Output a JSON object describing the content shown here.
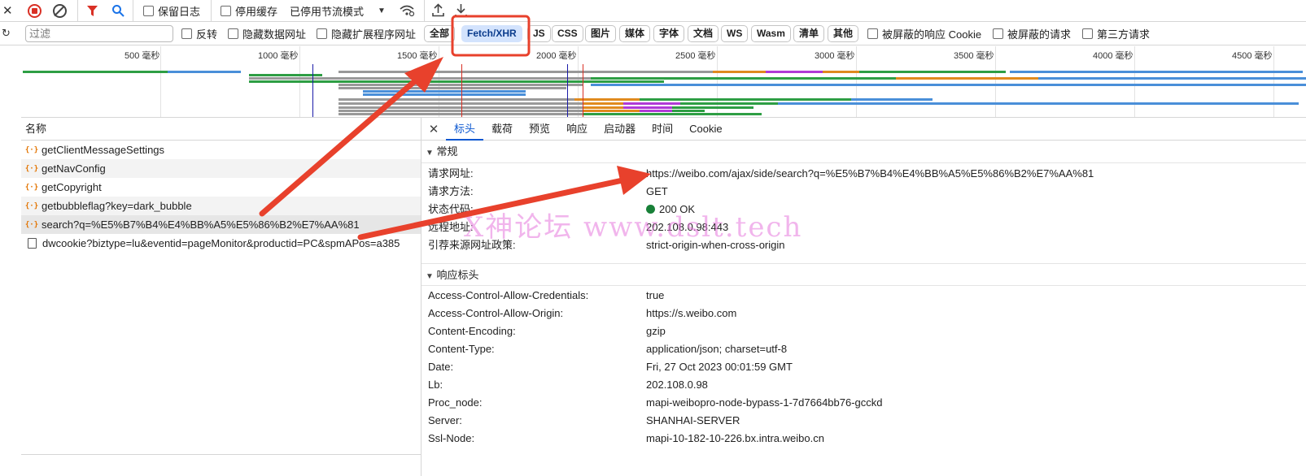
{
  "toolbar": {
    "preserve_log": "保留日志",
    "disable_cache": "停用缓存",
    "throttle": "已停用节流模式"
  },
  "filterbar": {
    "filter_placeholder": "过滤",
    "invert": "反转",
    "hide_data_urls": "隐藏数据网址",
    "hide_extension_urls": "隐藏扩展程序网址",
    "types": [
      "全部",
      "Fetch/XHR",
      "JS",
      "CSS",
      "图片",
      "媒体",
      "字体",
      "文档",
      "WS",
      "Wasm",
      "清单",
      "其他"
    ],
    "active_type": "Fetch/XHR",
    "blocked_cookies": "被屏蔽的响应 Cookie",
    "blocked_requests": "被屏蔽的请求",
    "third_party": "第三方请求"
  },
  "timeline": {
    "ticks": [
      "500 毫秒",
      "1000 毫秒",
      "1500 毫秒",
      "2000 毫秒",
      "2500 毫秒",
      "3000 毫秒",
      "3500 毫秒",
      "4000 毫秒",
      "4500 毫秒"
    ]
  },
  "requests": {
    "column_name": "名称",
    "items": [
      {
        "name": "getClientMessageSettings",
        "type": "xhr"
      },
      {
        "name": "getNavConfig",
        "type": "xhr"
      },
      {
        "name": "getCopyright",
        "type": "xhr"
      },
      {
        "name": "getbubbleflag?key=dark_bubble",
        "type": "xhr"
      },
      {
        "name": "search?q=%E5%B7%B4%E4%BB%A5%E5%86%B2%E7%AA%81",
        "type": "xhr"
      },
      {
        "name": "dwcookie?biztype=lu&eventid=pageMonitor&productid=PC&spmAPos=a385",
        "type": "doc"
      }
    ],
    "selected_index": 4
  },
  "details": {
    "tabs": [
      "标头",
      "载荷",
      "预览",
      "响应",
      "启动器",
      "时间",
      "Cookie"
    ],
    "active_tab": "标头",
    "general_title": "常规",
    "general": [
      {
        "k": "请求网址:",
        "v": "https://weibo.com/ajax/side/search?q=%E5%B7%B4%E4%BB%A5%E5%86%B2%E7%AA%81"
      },
      {
        "k": "请求方法:",
        "v": "GET"
      },
      {
        "k": "状态代码:",
        "v": "200 OK"
      },
      {
        "k": "远程地址:",
        "v": "202.108.0.98:443"
      },
      {
        "k": "引荐来源网址政策:",
        "v": "strict-origin-when-cross-origin"
      }
    ],
    "response_title": "响应标头",
    "response": [
      {
        "k": "Access-Control-Allow-Credentials:",
        "v": "true"
      },
      {
        "k": "Access-Control-Allow-Origin:",
        "v": "https://s.weibo.com"
      },
      {
        "k": "Content-Encoding:",
        "v": "gzip"
      },
      {
        "k": "Content-Type:",
        "v": "application/json; charset=utf-8"
      },
      {
        "k": "Date:",
        "v": "Fri, 27 Oct 2023 00:01:59 GMT"
      },
      {
        "k": "Lb:",
        "v": "202.108.0.98"
      },
      {
        "k": "Proc_node:",
        "v": "mapi-weibopro-node-bypass-1-7d7664bb76-gcckd"
      },
      {
        "k": "Server:",
        "v": "SHANHAI-SERVER"
      },
      {
        "k": "Ssl-Node:",
        "v": "mapi-10-182-10-226.bx.intra.weibo.cn"
      }
    ]
  },
  "watermark": "Ⅹ神论坛  www.dslt.tech",
  "colors": {
    "accent": "#0b57d0",
    "annotation": "#e8412c",
    "status_ok": "#188038"
  }
}
